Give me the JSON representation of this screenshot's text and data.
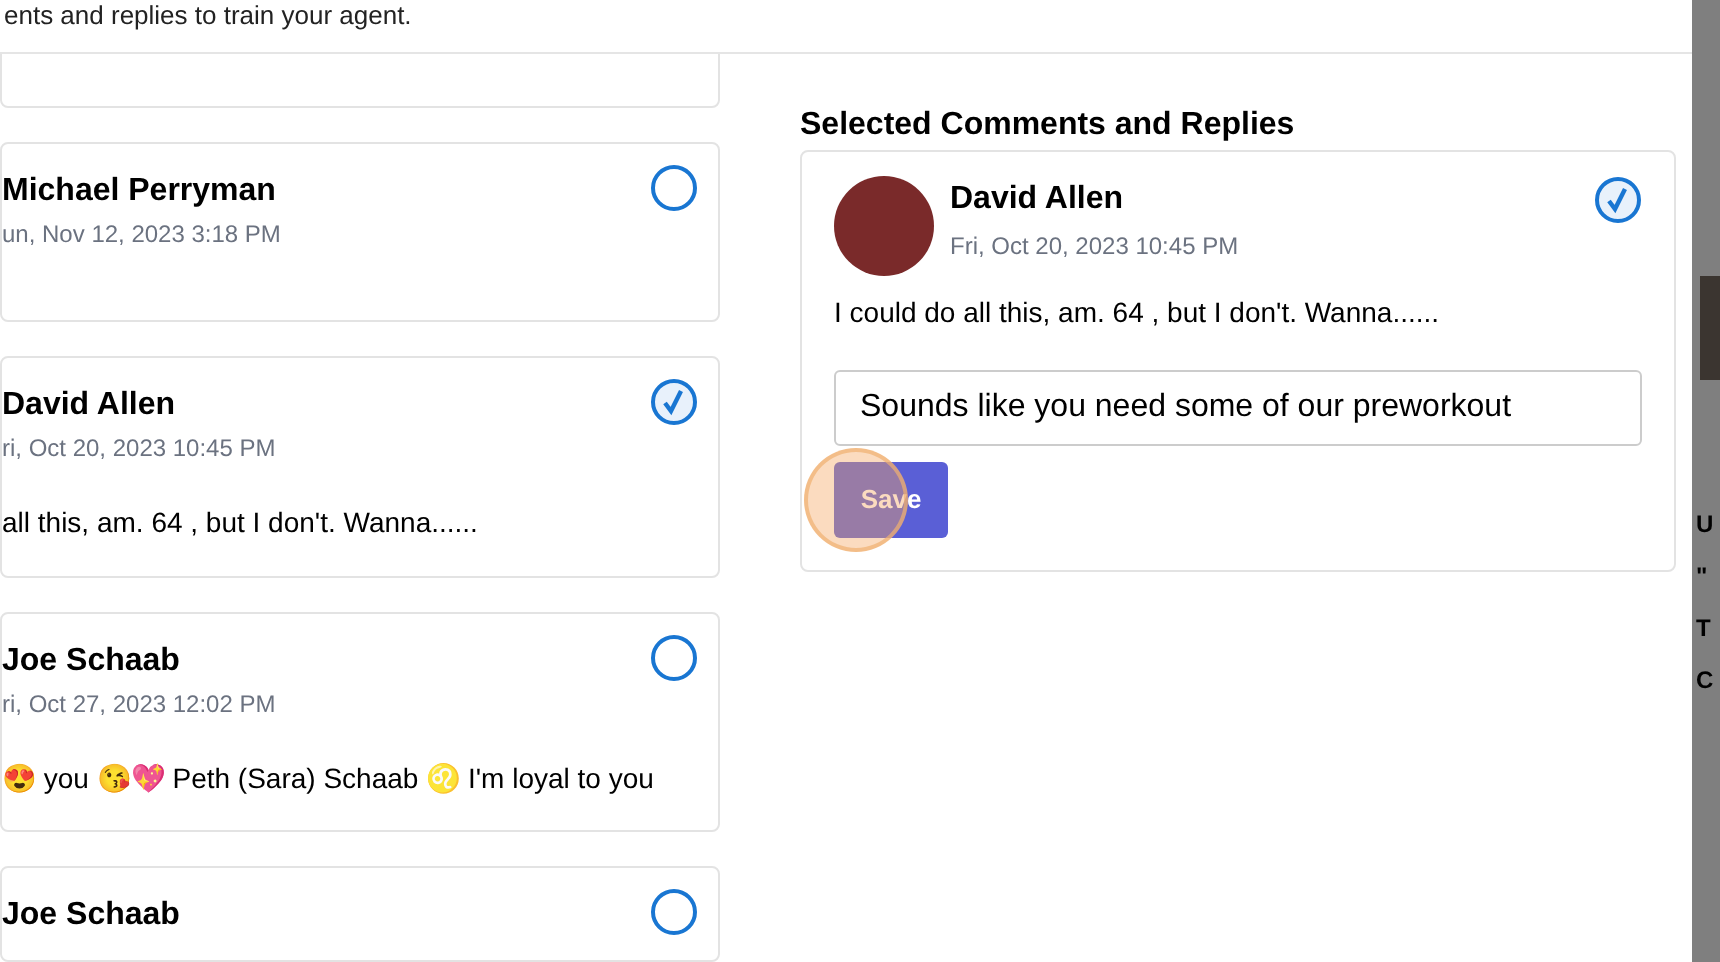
{
  "header": {
    "subtitle": "ents and replies to train your agent."
  },
  "comments": [
    {
      "kind": "top"
    },
    {
      "kind": "full",
      "name": "Michael Perryman",
      "date": "un, Nov 12, 2023 3:18 PM",
      "selected": false
    },
    {
      "kind": "full",
      "name": "David Allen",
      "date": "ri, Oct 20, 2023 10:45 PM",
      "text": "all this, am. 64 , but I don't. Wanna......",
      "selected": true
    },
    {
      "kind": "full",
      "name": "Joe Schaab",
      "date": "ri, Oct 27, 2023 12:02 PM",
      "text": "😍 you 😘💖 Peth (Sara) Schaab ♌ I'm loyal to you",
      "selected": false
    },
    {
      "kind": "bottom",
      "name": "Joe Schaab",
      "selected": false
    }
  ],
  "selected_panel": {
    "title": "Selected Comments and Replies",
    "items": [
      {
        "name": "David Allen",
        "date": "Fri, Oct 20, 2023 10:45 PM",
        "text": "I could do all this, am. 64 , but I don't. Wanna......",
        "selected": true,
        "reply": "Sounds like you need some of our preworkout",
        "button": "Save"
      }
    ]
  },
  "background_panel": {
    "lines": [
      "U",
      "\"",
      "T",
      "C"
    ]
  }
}
